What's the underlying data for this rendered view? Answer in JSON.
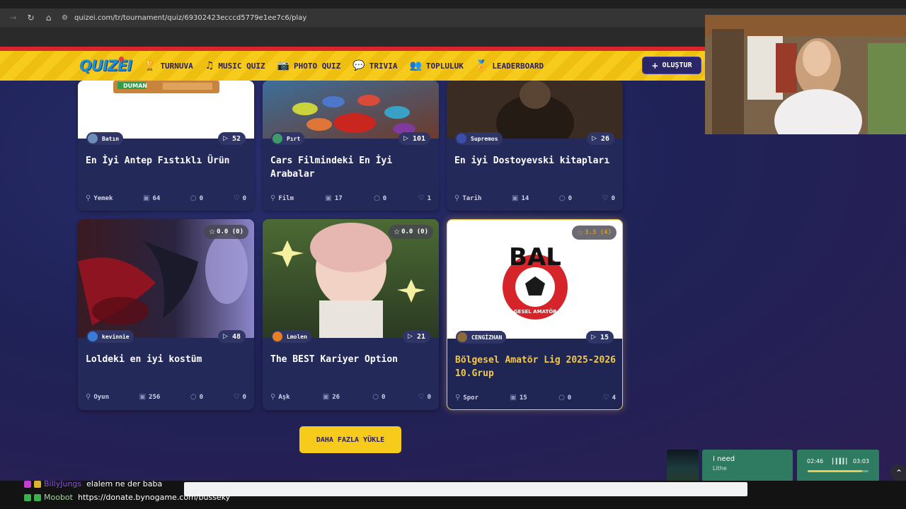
{
  "browser": {
    "url": "quizei.com/tr/tournament/quiz/69302423ecccd5779e1ee7c6/play",
    "back_icon": "←",
    "forward_icon": "→",
    "reload_icon": "↻",
    "home_icon": "⌂",
    "tune_icon": "⚙"
  },
  "header": {
    "logo": "QUIZEI",
    "nav": [
      {
        "label": "TURNUVA",
        "icon": "🏆"
      },
      {
        "label": "MUSIC QUIZ",
        "icon": "♫"
      },
      {
        "label": "PHOTO QUIZ",
        "icon": "📷"
      },
      {
        "label": "TRIVIA",
        "icon": "💬"
      },
      {
        "label": "TOPLULUK",
        "icon": "👥"
      },
      {
        "label": "LEADERBOARD",
        "icon": "🏅"
      }
    ],
    "create": {
      "label": "OLUŞTUR",
      "icon": "+"
    }
  },
  "cards": [
    {
      "creator": "Batın",
      "plays": "52",
      "title": "En İyi Antep Fıstıklı Ürün",
      "category": "Yemek",
      "items": "64",
      "comments": "0",
      "likes": "0"
    },
    {
      "creator": "Pırt",
      "plays": "101",
      "title": "Cars Filmindeki En İyi Arabalar",
      "category": "Film",
      "items": "17",
      "comments": "0",
      "likes": "1"
    },
    {
      "creator": "Supremos",
      "plays": "26",
      "title": "En iyi Dostoyevski kitapları",
      "category": "Tarih",
      "items": "14",
      "comments": "0",
      "likes": "0"
    },
    {
      "creator": "kevinnie",
      "plays": "48",
      "title": "Loldeki en iyi kostüm",
      "category": "Oyun",
      "items": "256",
      "comments": "0",
      "likes": "0",
      "rating": "0.0 (0)"
    },
    {
      "creator": "Lmolen",
      "plays": "21",
      "title": "The BEST Kariyer Option",
      "category": "Aşk",
      "items": "26",
      "comments": "0",
      "likes": "0",
      "rating": "0.0 (0)"
    },
    {
      "creator": "CENGİZHAN",
      "plays": "15",
      "title": "Bölgesel Amatör Lig 2025-2026 10.Grup",
      "category": "Spor",
      "items": "15",
      "comments": "0",
      "likes": "4",
      "rating": "3.3 (4)",
      "logo_text": "BAL",
      "logo_subtext": "BÖLGESEL AMATÖR LİG"
    }
  ],
  "load_more": "DAHA FAZLA YÜKLE",
  "music": {
    "title": "I need",
    "artist": "Lithe",
    "time_start": "02:46",
    "time_end": "03:03",
    "progress": 0.9
  },
  "chat": [
    {
      "user": "BillyJungs",
      "message": "elalem ne der baba"
    },
    {
      "user": "Moobot",
      "message": "https://donate.bynogame.com/busseky"
    }
  ],
  "colors": {
    "header_yellow": "#f7cb1b",
    "accent_red": "#d8262f",
    "card_bg": "#232a5a",
    "highlight": "#f2c94c"
  }
}
